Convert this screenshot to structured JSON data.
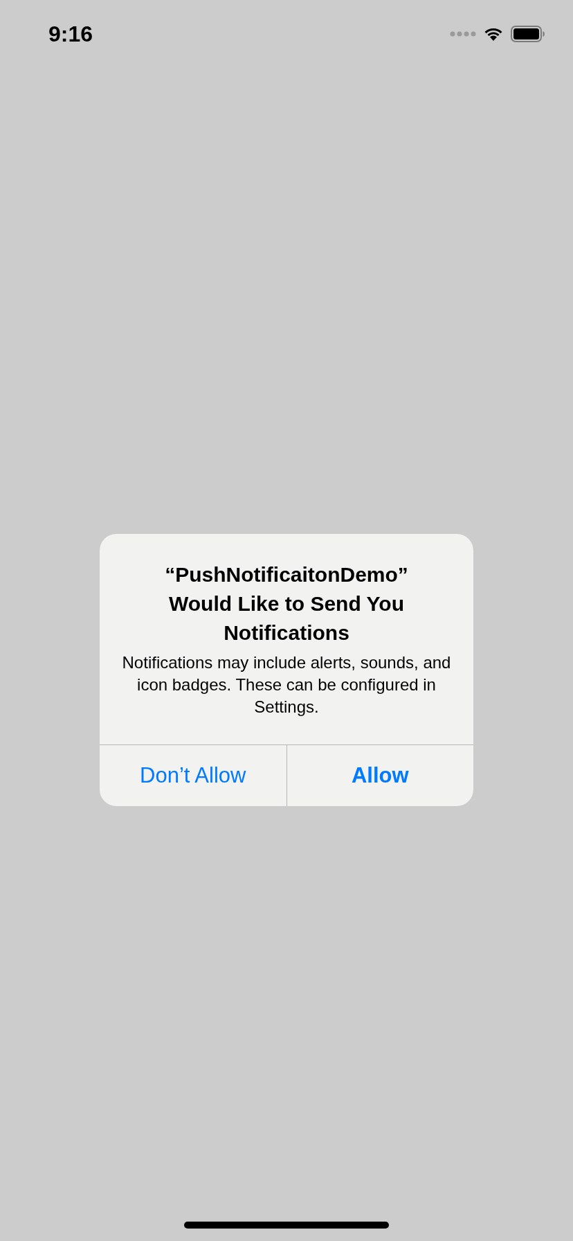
{
  "status_bar": {
    "time": "9:16"
  },
  "alert": {
    "title": "“PushNotificaitonDemo” Would Like to Send You Notifications",
    "message": "Notifications may include alerts, sounds, and icon badges. These can be configured in Settings.",
    "buttons": [
      {
        "label": "Don’t Allow",
        "kind": "cancel"
      },
      {
        "label": "Allow",
        "kind": "default"
      }
    ]
  }
}
